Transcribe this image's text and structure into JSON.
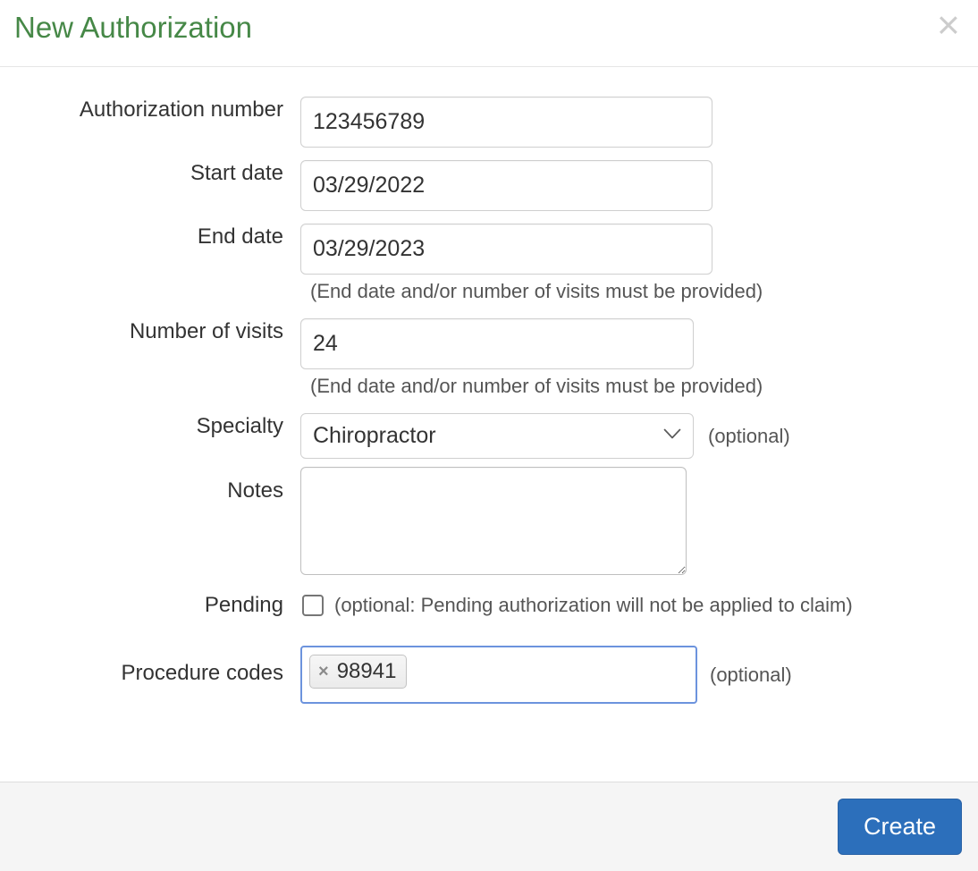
{
  "dialog": {
    "title": "New Authorization",
    "close_icon": "close-icon"
  },
  "form": {
    "authorization_number": {
      "label": "Authorization number",
      "value": "123456789",
      "placeholder": ""
    },
    "start_date": {
      "label": "Start date",
      "value": "03/29/2022",
      "placeholder": ""
    },
    "end_date": {
      "label": "End date",
      "value": "03/29/2023",
      "placeholder": "",
      "help": "(End date and/or number of visits must be provided)"
    },
    "number_of_visits": {
      "label": "Number of visits",
      "value": "24",
      "placeholder": "",
      "help": "(End date and/or number of visits must be provided)"
    },
    "specialty": {
      "label": "Specialty",
      "value": "Chiropractor",
      "optional_note": "(optional)",
      "chevron_icon": "chevron-down-icon"
    },
    "notes": {
      "label": "Notes",
      "value": "",
      "placeholder": ""
    },
    "pending": {
      "label": "Pending",
      "checked": false,
      "note": "(optional: Pending authorization will not be applied to claim)"
    },
    "procedure_codes": {
      "label": "Procedure codes",
      "optional_note": "(optional)",
      "tags": [
        {
          "remove_icon": "×",
          "label": "98941"
        }
      ]
    }
  },
  "footer": {
    "create_label": "Create"
  },
  "colors": {
    "title_green": "#468847",
    "primary_blue": "#2c6fbb",
    "focus_blue": "#6c93dd",
    "footer_bg": "#f5f5f5",
    "help_text": "#555555"
  }
}
